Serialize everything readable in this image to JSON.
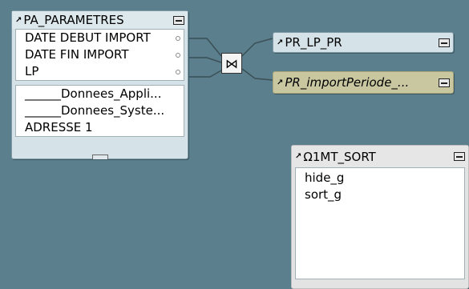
{
  "tables": {
    "params": {
      "title": "PA_PARAMETRES",
      "fields": [
        "DATE DEBUT IMPORT",
        "DATE FIN IMPORT",
        "LP"
      ],
      "extra_fields": [
        "______Donnees_Appli...",
        "______Donnees_Syste...",
        "ADRESSE 1"
      ]
    },
    "lp": {
      "title": "PR_LP_PR"
    },
    "import": {
      "title": "PR_importPeriode_..."
    },
    "sort": {
      "title": "Ω1MT_SORT",
      "fields": [
        "hide_g",
        "sort_g"
      ]
    }
  },
  "join": {
    "icon_name": "join-bowtie-icon",
    "symbol": "⋈"
  },
  "colors": {
    "background": "#5b7f8c",
    "link_line": "#3b4f56",
    "highlight_table": "#c9c7a0"
  }
}
